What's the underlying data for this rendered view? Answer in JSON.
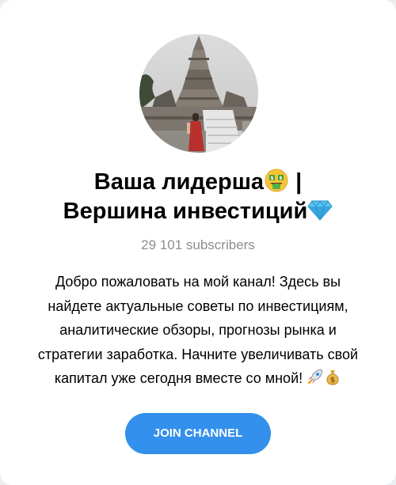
{
  "channel": {
    "title_line1": "Ваша лидерша",
    "title_sep": " |",
    "title_line2": "Вершина инвестиций",
    "title_emoji_1": "money-mouth-face-icon",
    "title_emoji_2": "gem-icon",
    "subscribers": "29 101 subscribers",
    "description_lines": [
      "Добро пожаловать на мой канал! Здесь вы",
      "найдете актуальные советы по инвестициям,",
      "аналитические обзоры, прогнозы рынка и",
      "стратегии заработка. Начните увеличивать свой",
      "капитал уже сегодня вместе со мной!"
    ],
    "description_emojis": [
      "rocket-icon",
      "money-bag-icon"
    ]
  },
  "join_button": {
    "label": "JOIN CHANNEL"
  },
  "colors": {
    "accent": "#3390ec",
    "subtext": "#8d8d8d",
    "background": "#ffffff"
  }
}
